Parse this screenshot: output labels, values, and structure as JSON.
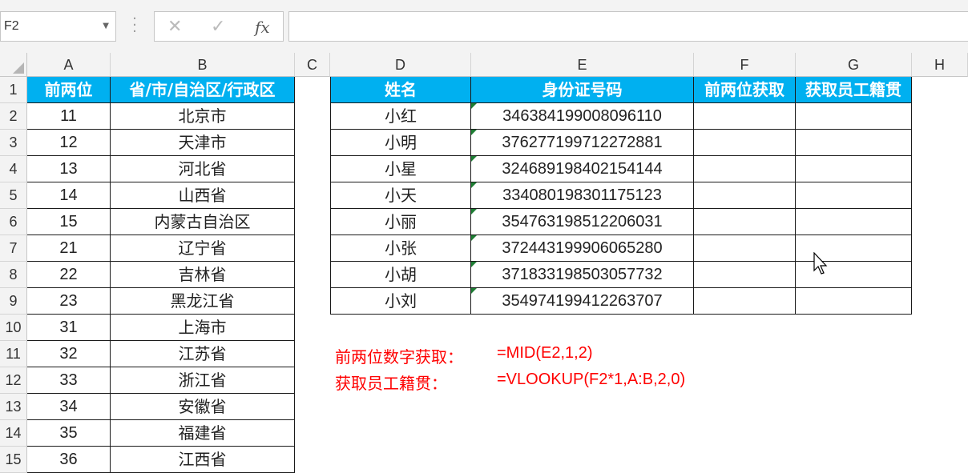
{
  "name_box": "F2",
  "formula_bar": {
    "cancel_icon": "✕",
    "enter_icon": "✓",
    "fx_label": "fx",
    "value": ""
  },
  "columns": [
    "A",
    "B",
    "C",
    "D",
    "E",
    "F",
    "G",
    "H"
  ],
  "rows": [
    "1",
    "2",
    "3",
    "4",
    "5",
    "6",
    "7",
    "8",
    "9",
    "10",
    "11",
    "12",
    "13",
    "14",
    "15"
  ],
  "province_table": {
    "headers": [
      "前两位",
      "省/市/自治区/行政区"
    ],
    "rows": [
      [
        "11",
        "北京市"
      ],
      [
        "12",
        "天津市"
      ],
      [
        "13",
        "河北省"
      ],
      [
        "14",
        "山西省"
      ],
      [
        "15",
        "内蒙古自治区"
      ],
      [
        "21",
        "辽宁省"
      ],
      [
        "22",
        "吉林省"
      ],
      [
        "23",
        "黑龙江省"
      ],
      [
        "31",
        "上海市"
      ],
      [
        "32",
        "江苏省"
      ],
      [
        "33",
        "浙江省"
      ],
      [
        "34",
        "安徽省"
      ],
      [
        "35",
        "福建省"
      ],
      [
        "36",
        "江西省"
      ]
    ]
  },
  "employee_table": {
    "headers": [
      "姓名",
      "身份证号码",
      "前两位获取",
      "获取员工籍贯"
    ],
    "rows": [
      [
        "小红",
        "346384199008096110",
        "",
        ""
      ],
      [
        "小明",
        "376277199712272881",
        "",
        ""
      ],
      [
        "小星",
        "324689198402154144",
        "",
        ""
      ],
      [
        "小天",
        "334080198301175123",
        "",
        ""
      ],
      [
        "小丽",
        "354763198512206031",
        "",
        ""
      ],
      [
        "小张",
        "372443199906065280",
        "",
        ""
      ],
      [
        "小胡",
        "371833198503057732",
        "",
        ""
      ],
      [
        "小刘",
        "354974199412263707",
        "",
        ""
      ]
    ]
  },
  "notes": [
    {
      "label": "前两位数字获取：",
      "formula": "=MID(E2,1,2)"
    },
    {
      "label": "获取员工籍贯：",
      "formula": "=VLOOKUP(F2*1,A:B,2,0)"
    }
  ],
  "colors": {
    "header_fill": "#00b0f0",
    "note_text": "#ff0000",
    "chrome": "#f3f3f3"
  }
}
